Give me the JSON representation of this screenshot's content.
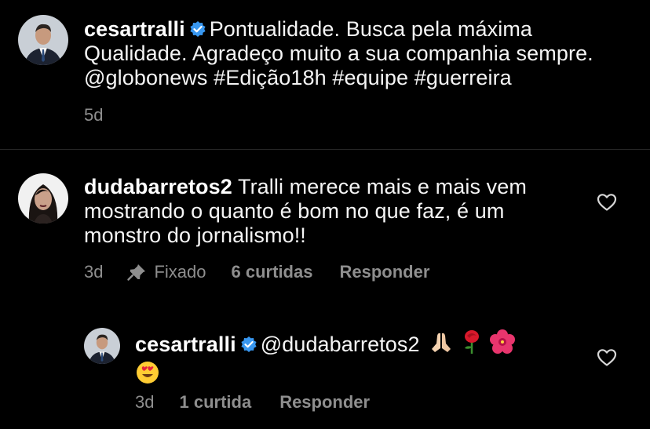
{
  "comment1": {
    "username": "cesartralli",
    "line1": "Pontualidade. Busca pela máxima",
    "line2": "Qualidade. Agradeço muito a sua companhia sempre.",
    "line3": "@globonews #Edição18h #equipe #guerreira",
    "time": "5d"
  },
  "comment2": {
    "username": "dudabarretos2",
    "line1": "Tralli merece mais e mais vem",
    "line2": "mostrando o quanto é bom no que faz, é um",
    "line3": "monstro do jornalismo!!",
    "time": "3d",
    "pinned_label": "Fixado",
    "likes": "6 curtidas",
    "reply_label": "Responder"
  },
  "reply1": {
    "username": "cesartralli",
    "mention": "@dudabarretos2",
    "time": "3d",
    "likes": "1 curtida",
    "reply_label": "Responder"
  },
  "icons": {
    "verified": "verified-badge-icon",
    "pin": "pin-icon",
    "heart": "heart-outline-icon"
  },
  "colors": {
    "background": "#000000",
    "text": "#f5f5f5",
    "meta": "#8e8e8e",
    "verified": "#3897f0",
    "divider": "#262626"
  }
}
